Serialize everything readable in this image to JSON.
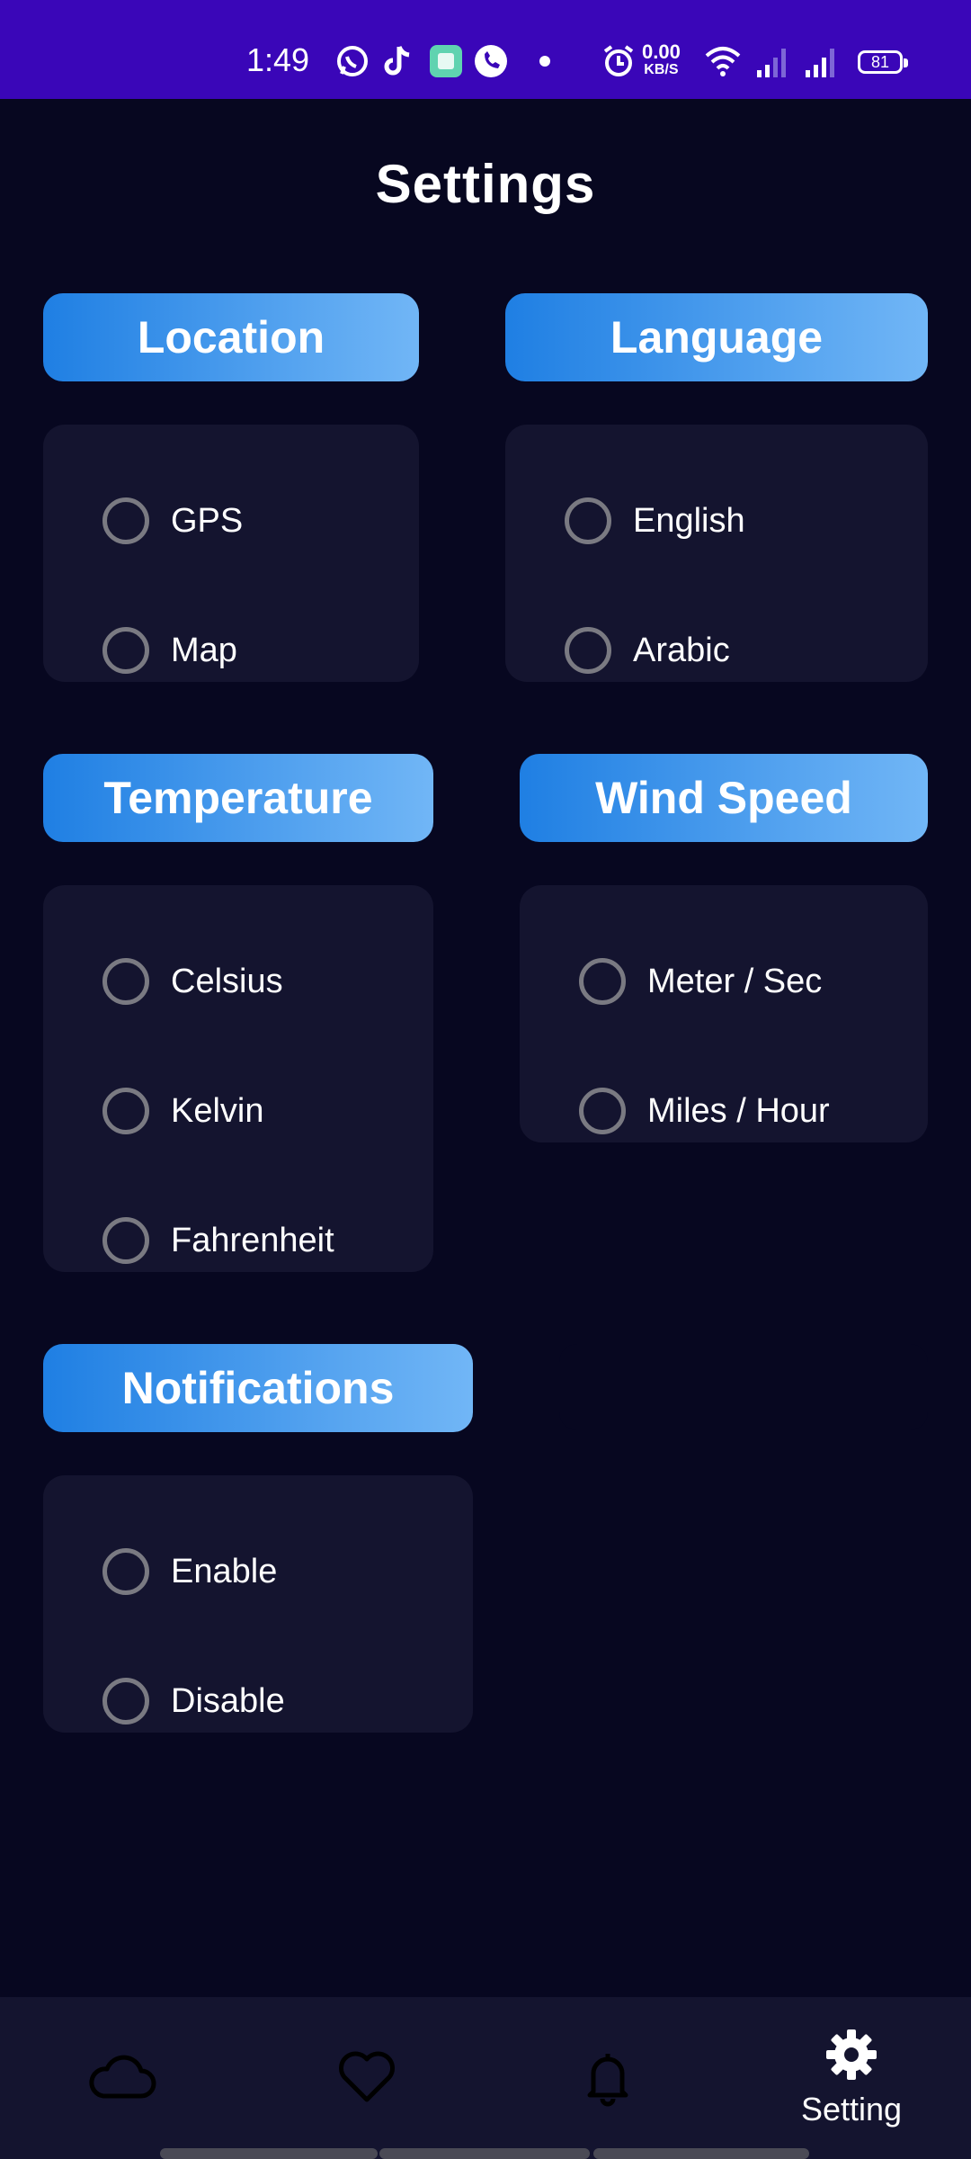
{
  "status_bar": {
    "time": "1:49",
    "net_speed_value": "0.00",
    "net_speed_unit": "KB/S",
    "battery": "81",
    "icons": [
      "whatsapp-icon",
      "tiktok-icon",
      "app-icon",
      "phone-call-icon",
      "dot-icon",
      "alarm-icon",
      "wifi-icon",
      "signal-icon",
      "signal-icon-2",
      "battery-icon"
    ]
  },
  "page": {
    "title": "Settings"
  },
  "sections": {
    "location": {
      "title": "Location",
      "options": [
        "GPS",
        "Map"
      ]
    },
    "language": {
      "title": "Language",
      "options": [
        "English",
        "Arabic"
      ]
    },
    "temperature": {
      "title": "Temperature",
      "options": [
        "Celsius",
        "Kelvin",
        "Fahrenheit"
      ]
    },
    "wind_speed": {
      "title": "Wind Speed",
      "options": [
        "Meter / Sec",
        "Miles / Hour"
      ]
    },
    "notifications": {
      "title": "Notifications",
      "options": [
        "Enable",
        "Disable"
      ]
    }
  },
  "bottom_nav": {
    "items": [
      {
        "icon": "cloud-icon",
        "label": ""
      },
      {
        "icon": "heart-icon",
        "label": ""
      },
      {
        "icon": "bell-icon",
        "label": ""
      },
      {
        "icon": "gear-icon",
        "label": "Setting"
      }
    ],
    "active_index": 3
  },
  "colors": {
    "background": "#070720",
    "status_bar": "#3a06b8",
    "card": "#14142f",
    "header_gradient_start": "#1f7fe3",
    "header_gradient_end": "#71b6f6",
    "radio_border": "#7a7a82"
  }
}
